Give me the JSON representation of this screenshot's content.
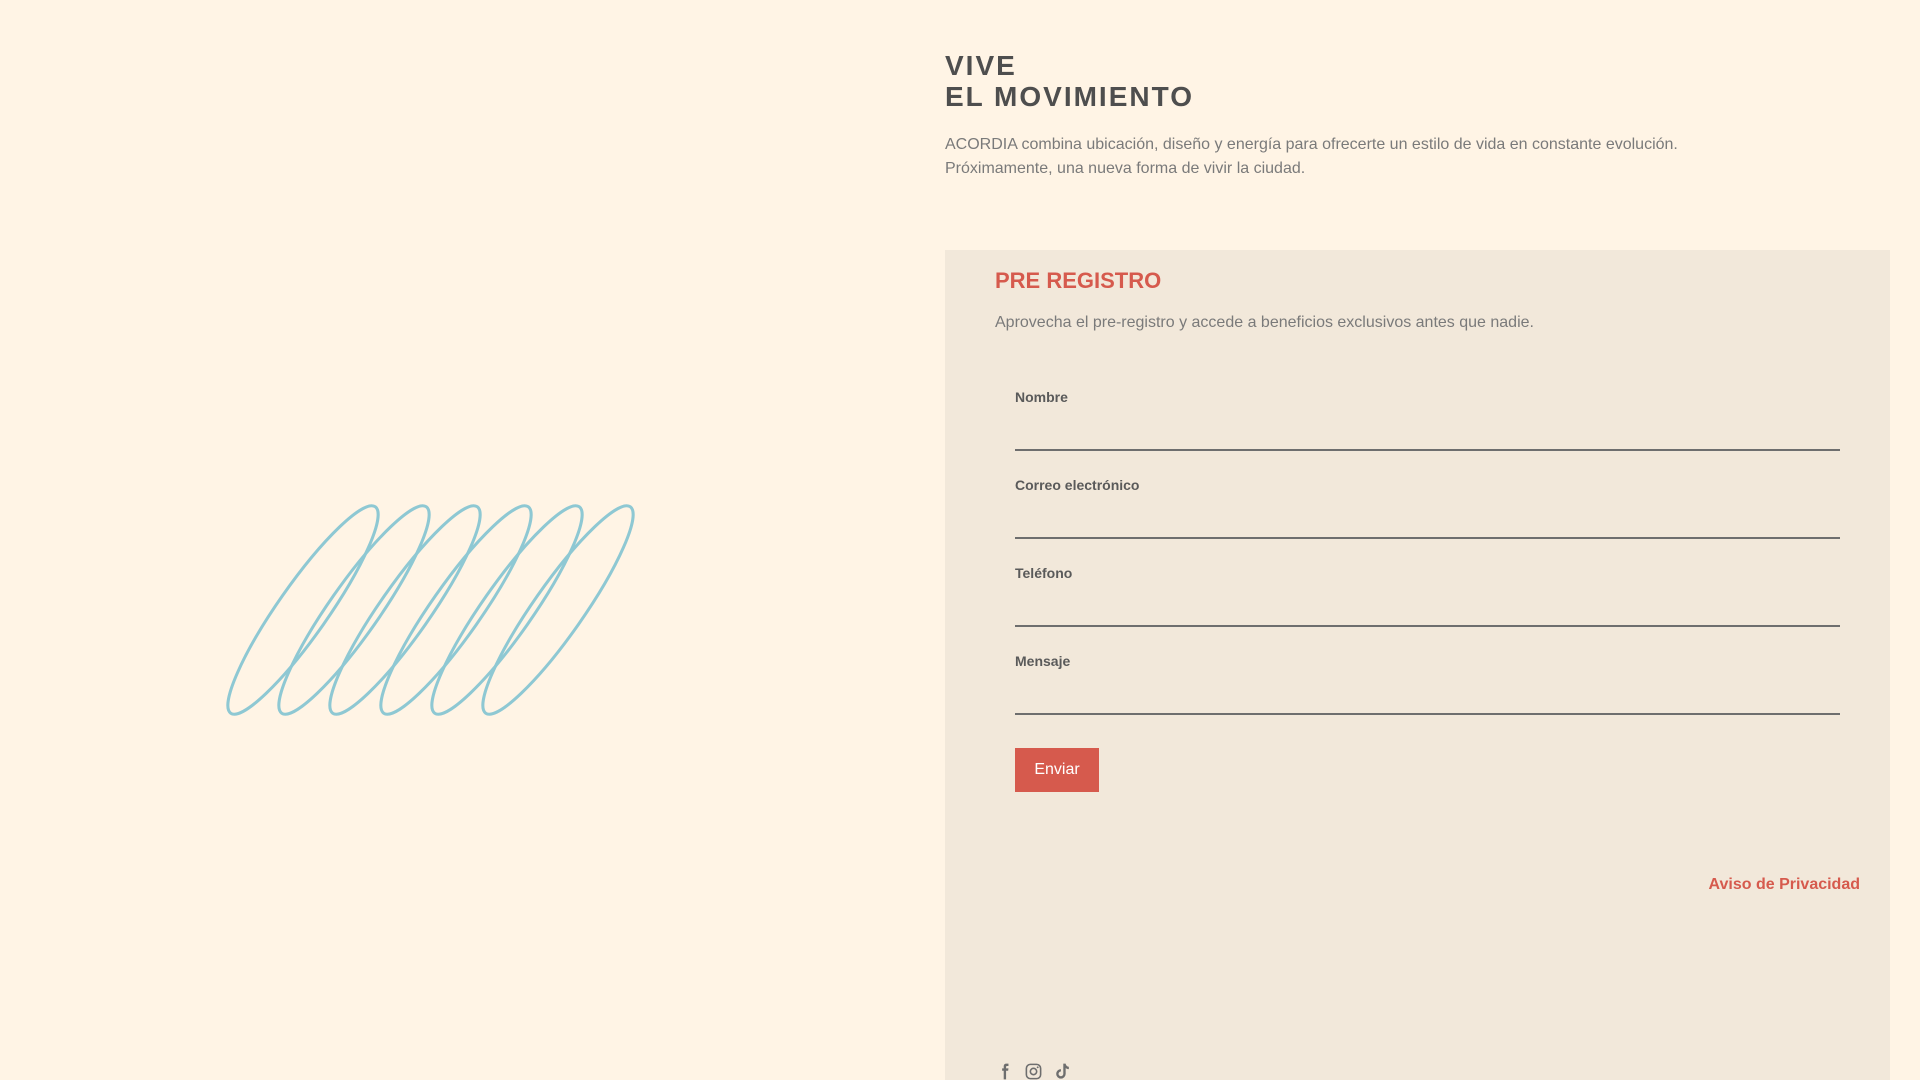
{
  "hero": {
    "title_line1": "VIVE",
    "title_line2": "EL MOVIMIENTO",
    "description_line1": "ACORDIA combina ubicación, diseño y energía para ofrecerte un estilo de vida en constante evolución.",
    "description_line2": "Próximamente, una nueva forma de vivir la ciudad."
  },
  "form": {
    "title": "PRE REGISTRO",
    "subtitle": "Aprovecha el pre-registro y accede a beneficios exclusivos antes que nadie.",
    "fields": [
      {
        "label": "Nombre",
        "value": "",
        "placeholder": ""
      },
      {
        "label": "Correo electrónico",
        "value": "",
        "placeholder": ""
      },
      {
        "label": "Teléfono",
        "value": "",
        "placeholder": ""
      },
      {
        "label": "Mensaje",
        "value": "",
        "placeholder": ""
      }
    ],
    "submit_label": "Enviar",
    "privacy_label": "Aviso de Privacidad"
  },
  "social": {
    "icons": [
      "facebook-icon",
      "instagram-icon",
      "tiktok-icon"
    ]
  },
  "colors": {
    "background": "#FFF4E5",
    "panel": "#F2E8DA",
    "accent": "#D65A4D",
    "logo": "#8EC8D3",
    "heading": "#4E4E4E",
    "body_text": "#7A7A7A"
  }
}
